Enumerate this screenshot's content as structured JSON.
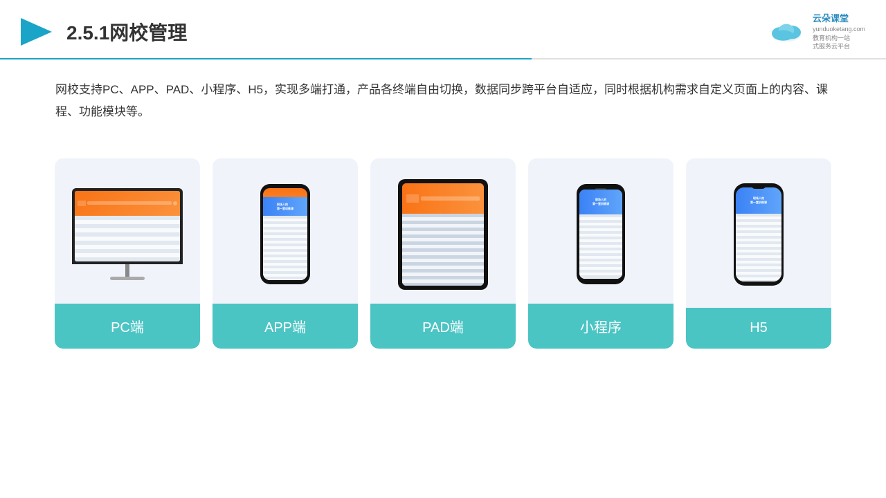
{
  "header": {
    "title": "2.5.1网校管理",
    "logo_brand": "云朵课堂",
    "logo_domain": "yunduoketang.com",
    "logo_slogan1": "教育机构一站",
    "logo_slogan2": "式服务云平台"
  },
  "description": {
    "text": "网校支持PC、APP、PAD、小程序、H5，实现多端打通，产品各终端自由切换，数据同步跨平台自适应，同时根据机构需求自定义页面上的内容、课程、功能模块等。"
  },
  "cards": [
    {
      "id": "pc",
      "label": "PC端"
    },
    {
      "id": "app",
      "label": "APP端"
    },
    {
      "id": "pad",
      "label": "PAD端"
    },
    {
      "id": "miniapp",
      "label": "小程序"
    },
    {
      "id": "h5",
      "label": "H5"
    }
  ],
  "colors": {
    "teal": "#4bc4c4",
    "accent": "#1aa5c8",
    "title_color": "#333"
  }
}
